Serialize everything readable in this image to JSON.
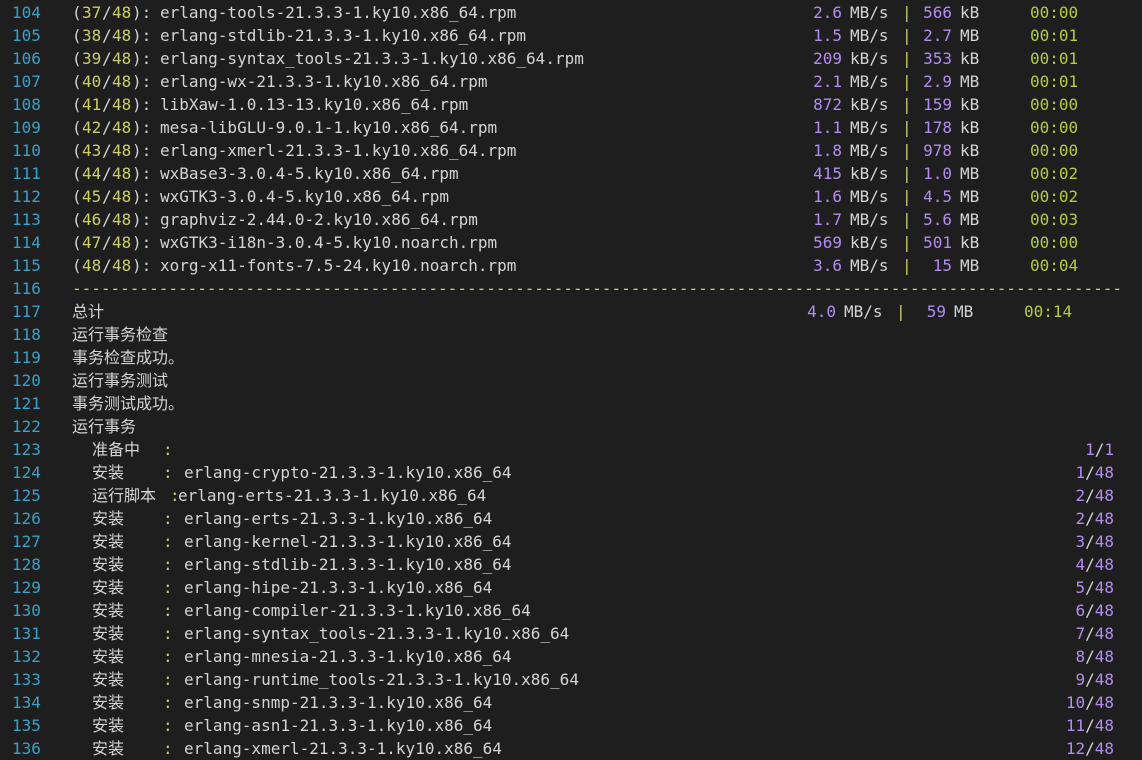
{
  "terminal": {
    "downloads": [
      {
        "ln": "104",
        "idx": "37",
        "total": "48",
        "pkg": "erlang-tools-21.3.3-1.ky10.x86_64.rpm",
        "speed": "2.6",
        "speed_unit": "MB/s",
        "size": "566",
        "size_unit": "kB",
        "time": "00:00"
      },
      {
        "ln": "105",
        "idx": "38",
        "total": "48",
        "pkg": "erlang-stdlib-21.3.3-1.ky10.x86_64.rpm",
        "speed": "1.5",
        "speed_unit": "MB/s",
        "size": "2.7",
        "size_unit": "MB",
        "time": "00:01"
      },
      {
        "ln": "106",
        "idx": "39",
        "total": "48",
        "pkg": "erlang-syntax_tools-21.3.3-1.ky10.x86_64.rpm",
        "speed": "209",
        "speed_unit": "kB/s",
        "size": "353",
        "size_unit": "kB",
        "time": "00:01"
      },
      {
        "ln": "107",
        "idx": "40",
        "total": "48",
        "pkg": "erlang-wx-21.3.3-1.ky10.x86_64.rpm",
        "speed": "2.1",
        "speed_unit": "MB/s",
        "size": "2.9",
        "size_unit": "MB",
        "time": "00:01"
      },
      {
        "ln": "108",
        "idx": "41",
        "total": "48",
        "pkg": "libXaw-1.0.13-13.ky10.x86_64.rpm",
        "speed": "872",
        "speed_unit": "kB/s",
        "size": "159",
        "size_unit": "kB",
        "time": "00:00"
      },
      {
        "ln": "109",
        "idx": "42",
        "total": "48",
        "pkg": "mesa-libGLU-9.0.1-1.ky10.x86_64.rpm",
        "speed": "1.1",
        "speed_unit": "MB/s",
        "size": "178",
        "size_unit": "kB",
        "time": "00:00"
      },
      {
        "ln": "110",
        "idx": "43",
        "total": "48",
        "pkg": "erlang-xmerl-21.3.3-1.ky10.x86_64.rpm",
        "speed": "1.8",
        "speed_unit": "MB/s",
        "size": "978",
        "size_unit": "kB",
        "time": "00:00"
      },
      {
        "ln": "111",
        "idx": "44",
        "total": "48",
        "pkg": "wxBase3-3.0.4-5.ky10.x86_64.rpm",
        "speed": "415",
        "speed_unit": "kB/s",
        "size": "1.0",
        "size_unit": "MB",
        "time": "00:02"
      },
      {
        "ln": "112",
        "idx": "45",
        "total": "48",
        "pkg": "wxGTK3-3.0.4-5.ky10.x86_64.rpm",
        "speed": "1.6",
        "speed_unit": "MB/s",
        "size": "4.5",
        "size_unit": "MB",
        "time": "00:02"
      },
      {
        "ln": "113",
        "idx": "46",
        "total": "48",
        "pkg": "graphviz-2.44.0-2.ky10.x86_64.rpm",
        "speed": "1.7",
        "speed_unit": "MB/s",
        "size": "5.6",
        "size_unit": "MB",
        "time": "00:03"
      },
      {
        "ln": "114",
        "idx": "47",
        "total": "48",
        "pkg": "wxGTK3-i18n-3.0.4-5.ky10.noarch.rpm",
        "speed": "569",
        "speed_unit": "kB/s",
        "size": "501",
        "size_unit": "kB",
        "time": "00:00"
      },
      {
        "ln": "115",
        "idx": "48",
        "total": "48",
        "pkg": "xorg-x11-fonts-7.5-24.ky10.noarch.rpm",
        "speed": "3.6",
        "speed_unit": "MB/s",
        "size": "15",
        "size_unit": "MB",
        "time": "00:04"
      }
    ],
    "separator": {
      "ln": "116",
      "text": "-------------------------------------------------------------------------------------------------------------"
    },
    "summary": {
      "ln": "117",
      "label": "总计",
      "speed": "4.0",
      "speed_unit": "MB/s",
      "size": "59",
      "size_unit": "MB",
      "time": "00:14"
    },
    "messages": [
      {
        "ln": "118",
        "text": "运行事务检查"
      },
      {
        "ln": "119",
        "text": "事务检查成功。"
      },
      {
        "ln": "120",
        "text": "运行事务测试"
      },
      {
        "ln": "121",
        "text": "事务测试成功。"
      },
      {
        "ln": "122",
        "text": "运行事务"
      }
    ],
    "steps": [
      {
        "ln": "123",
        "action": "准备中",
        "pkg": "",
        "num": "1",
        "den": "1"
      },
      {
        "ln": "124",
        "action": "安装",
        "pkg": "erlang-crypto-21.3.3-1.ky10.x86_64",
        "num": "1",
        "den": "48"
      },
      {
        "ln": "125",
        "action": "运行脚本",
        "pkg": "erlang-erts-21.3.3-1.ky10.x86_64",
        "num": "2",
        "den": "48"
      },
      {
        "ln": "126",
        "action": "安装",
        "pkg": "erlang-erts-21.3.3-1.ky10.x86_64",
        "num": "2",
        "den": "48"
      },
      {
        "ln": "127",
        "action": "安装",
        "pkg": "erlang-kernel-21.3.3-1.ky10.x86_64",
        "num": "3",
        "den": "48"
      },
      {
        "ln": "128",
        "action": "安装",
        "pkg": "erlang-stdlib-21.3.3-1.ky10.x86_64",
        "num": "4",
        "den": "48"
      },
      {
        "ln": "129",
        "action": "安装",
        "pkg": "erlang-hipe-21.3.3-1.ky10.x86_64",
        "num": "5",
        "den": "48"
      },
      {
        "ln": "130",
        "action": "安装",
        "pkg": "erlang-compiler-21.3.3-1.ky10.x86_64",
        "num": "6",
        "den": "48"
      },
      {
        "ln": "131",
        "action": "安装",
        "pkg": "erlang-syntax_tools-21.3.3-1.ky10.x86_64",
        "num": "7",
        "den": "48"
      },
      {
        "ln": "132",
        "action": "安装",
        "pkg": "erlang-mnesia-21.3.3-1.ky10.x86_64",
        "num": "8",
        "den": "48"
      },
      {
        "ln": "133",
        "action": "安装",
        "pkg": "erlang-runtime_tools-21.3.3-1.ky10.x86_64",
        "num": "9",
        "den": "48"
      },
      {
        "ln": "134",
        "action": "安装",
        "pkg": "erlang-snmp-21.3.3-1.ky10.x86_64",
        "num": "10",
        "den": "48"
      },
      {
        "ln": "135",
        "action": "安装",
        "pkg": "erlang-asn1-21.3.3-1.ky10.x86_64",
        "num": "11",
        "den": "48"
      },
      {
        "ln": "136",
        "action": "安装",
        "pkg": "erlang-xmerl-21.3.3-1.ky10.x86_64",
        "num": "12",
        "den": "48"
      }
    ],
    "colors": {
      "background": "#1e1e1e",
      "line_number": "#3aa0c8",
      "counter": "#cdcd6a",
      "number": "#b48cf0",
      "time": "#b5cc3c",
      "text": "#d4d4d4"
    }
  }
}
